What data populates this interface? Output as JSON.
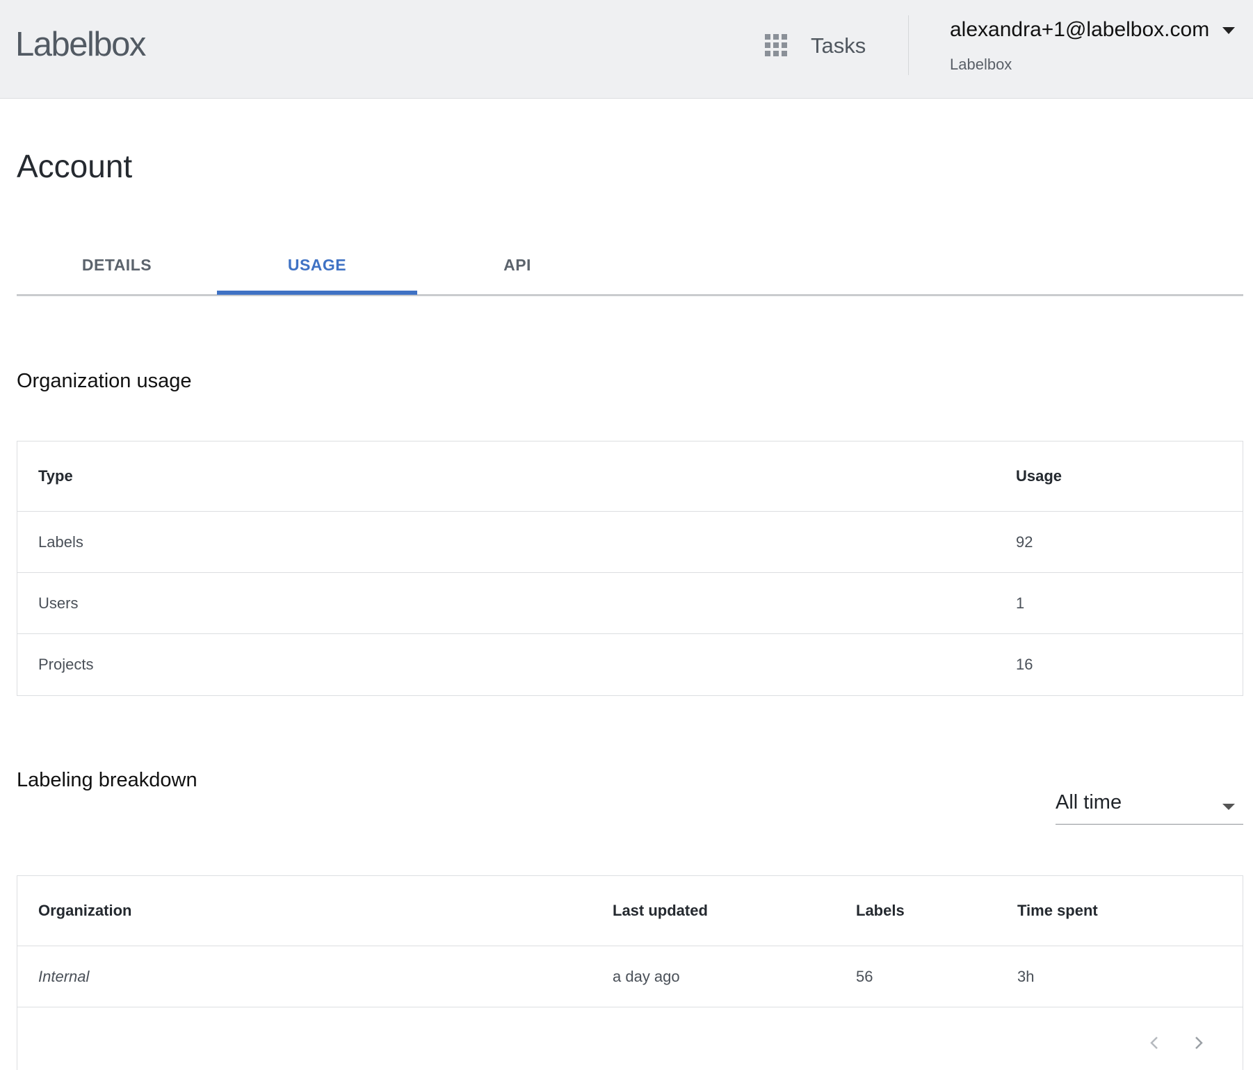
{
  "header": {
    "logo": "Labelbox",
    "tasks_label": "Tasks",
    "account_email": "alexandra+1@labelbox.com",
    "account_org": "Labelbox"
  },
  "page": {
    "title": "Account",
    "tabs": [
      {
        "label": "DETAILS",
        "active": false
      },
      {
        "label": "USAGE",
        "active": true
      },
      {
        "label": "API",
        "active": false
      }
    ]
  },
  "org_usage": {
    "title": "Organization usage",
    "columns": [
      "Type",
      "Usage"
    ],
    "rows": [
      {
        "type": "Labels",
        "usage": "92"
      },
      {
        "type": "Users",
        "usage": "1"
      },
      {
        "type": "Projects",
        "usage": "16"
      }
    ]
  },
  "labeling_breakdown": {
    "title": "Labeling breakdown",
    "range_value": "All time",
    "columns": [
      "Organization",
      "Last updated",
      "Labels",
      "Time spent"
    ],
    "rows": [
      {
        "organization": "Internal",
        "last_updated": "a day ago",
        "labels": "56",
        "time_spent": "3h"
      }
    ]
  },
  "icons": {
    "apps": "grid-icon",
    "account_menu": "caret-down-icon",
    "range_menu": "caret-down-icon",
    "prev_page": "chevron-left-icon",
    "next_page": "chevron-right-icon"
  },
  "colors": {
    "accent": "#3f72c4",
    "topbar_bg": "#eff0f2"
  }
}
